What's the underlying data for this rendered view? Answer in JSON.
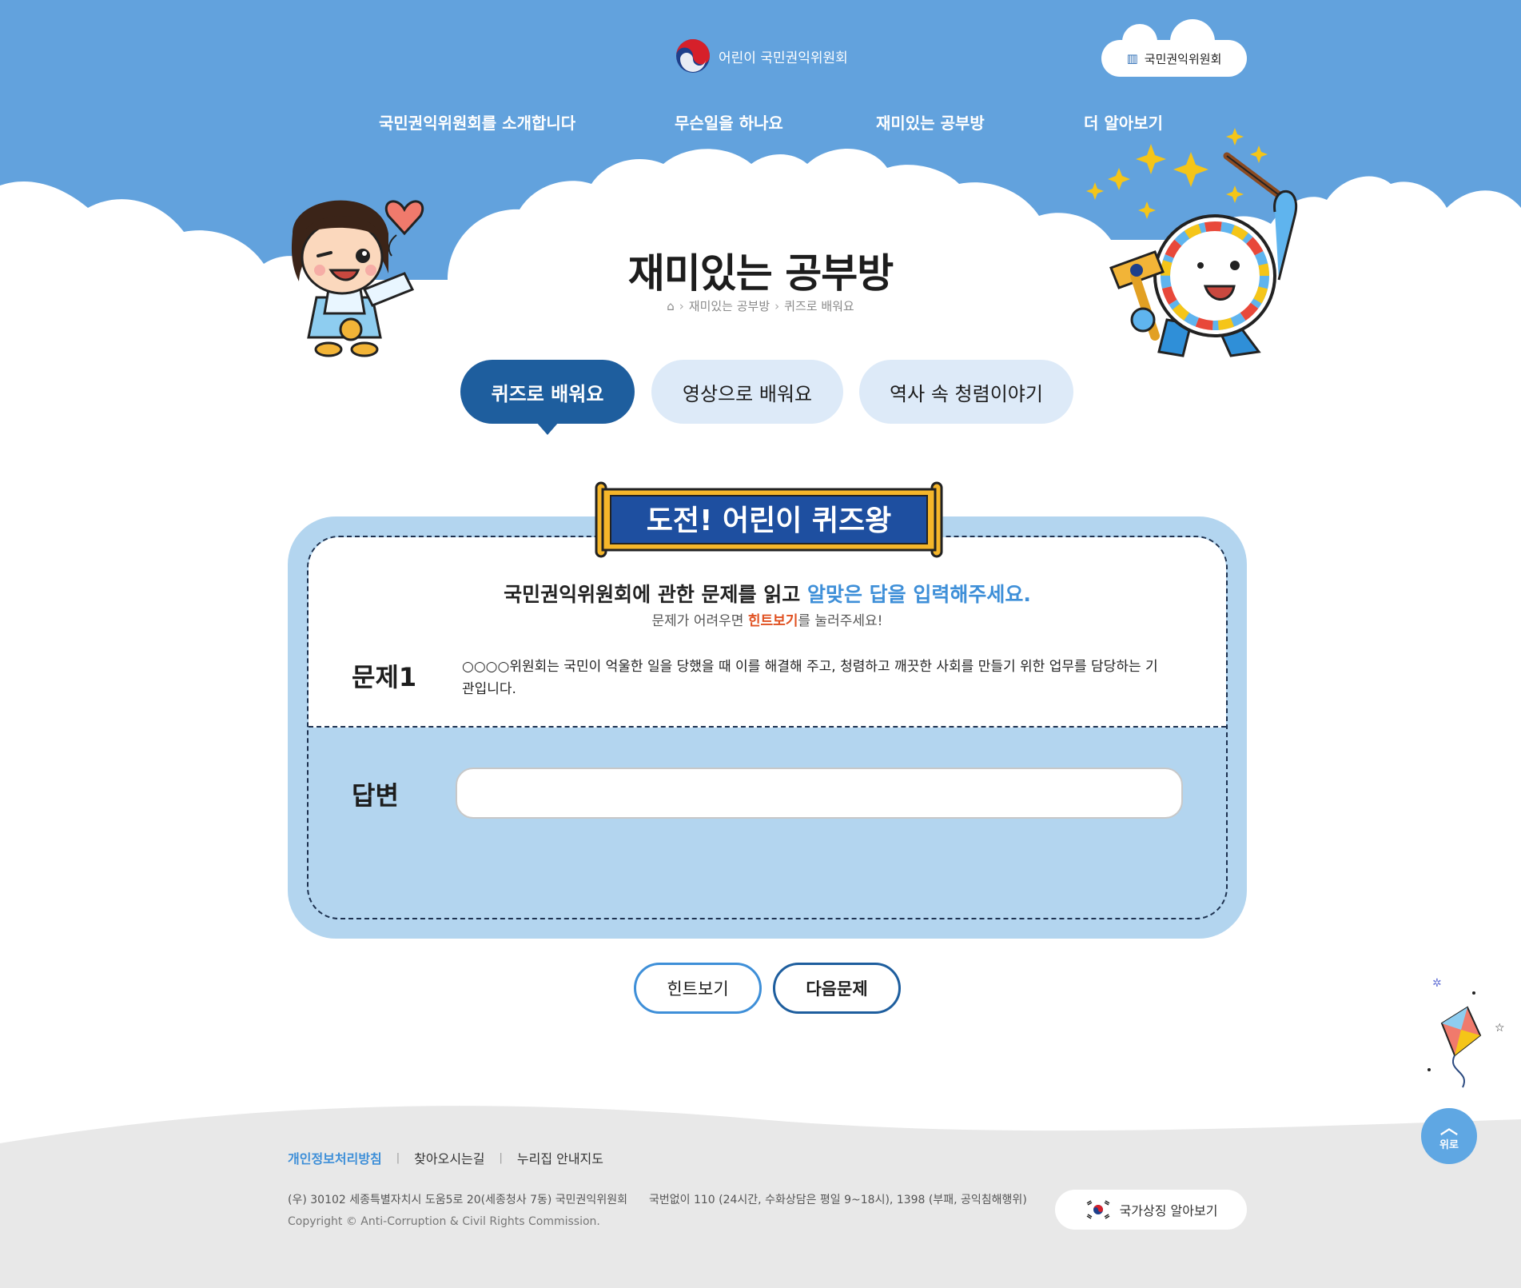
{
  "header": {
    "logo_text": "어린이 국민권익위원회",
    "site_link": "국민권익위원회"
  },
  "gnb": [
    {
      "label": "국민권익위원회를 소개합니다"
    },
    {
      "label": "무슨일을 하나요"
    },
    {
      "label": "재미있는 공부방"
    },
    {
      "label": "더 알아보기"
    }
  ],
  "page": {
    "title": "재미있는 공부방",
    "breadcrumb": [
      "재미있는 공부방",
      "퀴즈로 배워요"
    ]
  },
  "tabs": [
    {
      "label": "퀴즈로 배워요",
      "active": true
    },
    {
      "label": "영상으로 배워요",
      "active": false
    },
    {
      "label": "역사 속 청렴이야기",
      "active": false
    }
  ],
  "quiz": {
    "banner": "도전! 어린이 퀴즈왕",
    "intro_before": "국민권익위원회에 관한 문제를 읽고 ",
    "intro_highlight": "알맞은 답을 입력해주세요.",
    "sub_before": "문제가 어려우면 ",
    "sub_highlight": "힌트보기",
    "sub_after": "를 눌러주세요!",
    "question_label": "문제1",
    "question_text": "○○○○위원회는 국민이 억울한 일을 당했을 때 이를 해결해 주고, 청렴하고 깨끗한 사회를 만들기 위한 업무를 담당하는 기관입니다.",
    "answer_label": "답변",
    "answer_value": "",
    "hint_button": "힌트보기",
    "next_button": "다음문제"
  },
  "footer": {
    "links": [
      "개인정보처리방침",
      "찾아오시는길",
      "누리집 안내지도"
    ],
    "address": "(우) 30102 세종특별자치시 도움5로 20(세종청사 7동) 국민권익위원회",
    "phone": "국번없이 110 (24시간, 수화상담은 평일 9~18시), 1398 (부패, 공익침해행위)",
    "copyright": "Copyright © Anti-Corruption & Civil Rights Commission.",
    "symbol_button": "국가상징 알아보기",
    "top_button": "위로"
  },
  "colors": {
    "sky": "#62a2dd",
    "primary": "#1e5e9e",
    "accent": "#3e8fd8",
    "quiz_bg": "#b3d5ef",
    "hint_red": "#e05020"
  }
}
